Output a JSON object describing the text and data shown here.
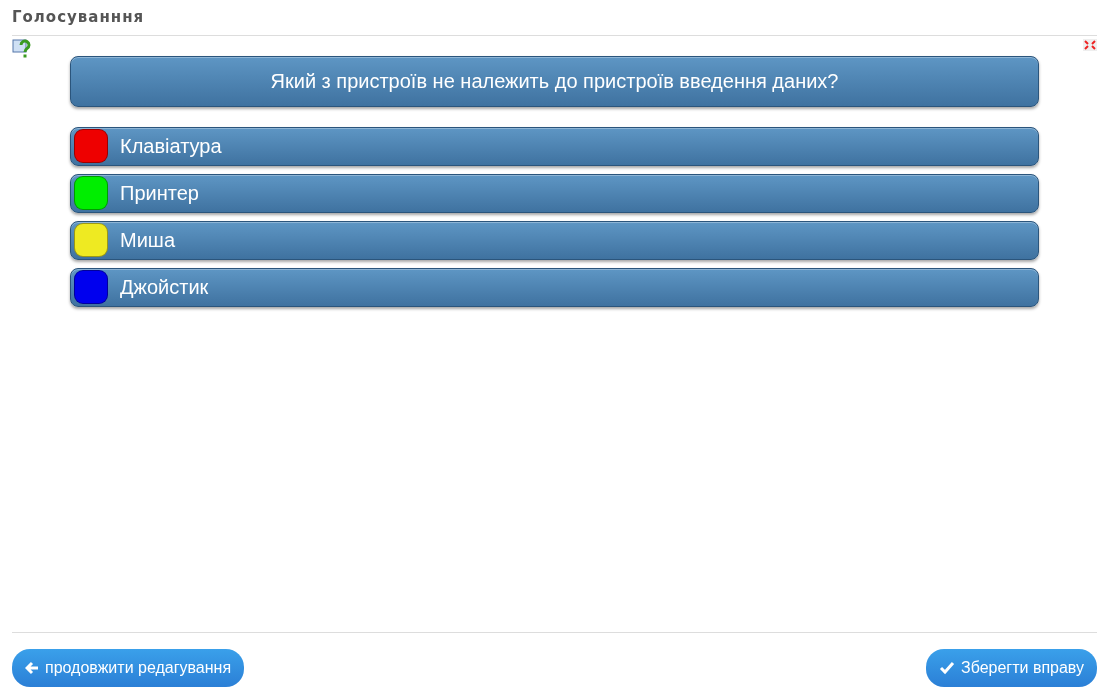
{
  "title": "Голосуванння",
  "question": "Який з пристроїв не належить до пристроїв введення даних?",
  "answers": [
    {
      "label": "Клавіатура",
      "color": "#ee0000"
    },
    {
      "label": "Принтер",
      "color": "#00ee00"
    },
    {
      "label": "Миша",
      "color": "#eeea22"
    },
    {
      "label": "Джойстик",
      "color": "#0000ee"
    }
  ],
  "buttons": {
    "back": "продовжити редагування",
    "save": "Зберегти вправу"
  }
}
